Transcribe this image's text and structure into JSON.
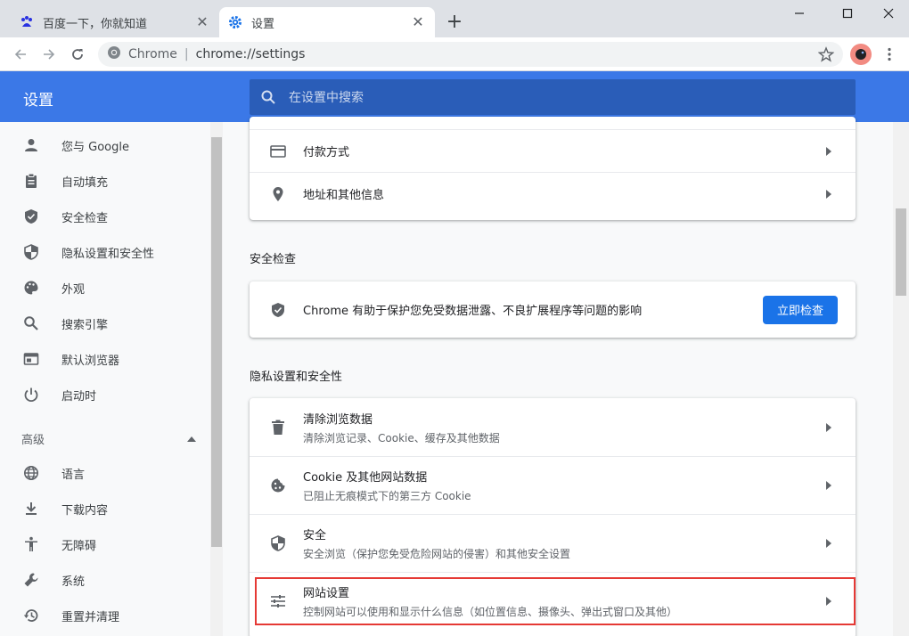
{
  "tabs": [
    {
      "title": "百度一下，你就知道",
      "icon": "baidu-icon"
    },
    {
      "title": "设置",
      "icon": "gear-icon"
    }
  ],
  "omnibox": {
    "site": "Chrome",
    "url": "chrome://settings"
  },
  "header": {
    "title": "设置",
    "search_placeholder": "在设置中搜索"
  },
  "sidebar": {
    "items": [
      {
        "label": "您与 Google",
        "icon": "person-icon"
      },
      {
        "label": "自动填充",
        "icon": "clipboard-icon"
      },
      {
        "label": "安全检查",
        "icon": "shield-check-icon"
      },
      {
        "label": "隐私设置和安全性",
        "icon": "shield-half-icon"
      },
      {
        "label": "外观",
        "icon": "palette-icon"
      },
      {
        "label": "搜索引擎",
        "icon": "search-icon"
      },
      {
        "label": "默认浏览器",
        "icon": "browser-icon"
      },
      {
        "label": "启动时",
        "icon": "power-icon"
      }
    ],
    "advanced": "高级",
    "advanced_items": [
      {
        "label": "语言",
        "icon": "globe-icon"
      },
      {
        "label": "下载内容",
        "icon": "download-icon"
      },
      {
        "label": "无障碍",
        "icon": "accessibility-icon"
      },
      {
        "label": "系统",
        "icon": "wrench-icon"
      },
      {
        "label": "重置并清理",
        "icon": "history-icon"
      }
    ]
  },
  "autofill": {
    "rows": [
      {
        "title": "付款方式",
        "icon": "credit-card-icon"
      },
      {
        "title": "地址和其他信息",
        "icon": "location-icon"
      }
    ]
  },
  "safety": {
    "title": "安全检查",
    "text": "Chrome 有助于保护您免受数据泄露、不良扩展程序等问题的影响",
    "button": "立即检查"
  },
  "privacy": {
    "title": "隐私设置和安全性",
    "rows": [
      {
        "title": "清除浏览数据",
        "sub": "清除浏览记录、Cookie、缓存及其他数据",
        "icon": "trash-icon"
      },
      {
        "title": "Cookie 及其他网站数据",
        "sub": "已阻止无痕模式下的第三方 Cookie",
        "icon": "cookie-icon"
      },
      {
        "title": "安全",
        "sub": "安全浏览（保护您免受危险网站的侵害）和其他安全设置",
        "icon": "shield-half-icon"
      },
      {
        "title": "网站设置",
        "sub": "控制网站可以使用和显示什么信息（如位置信息、摄像头、弹出式窗口及其他）",
        "icon": "tune-icon"
      }
    ]
  }
}
